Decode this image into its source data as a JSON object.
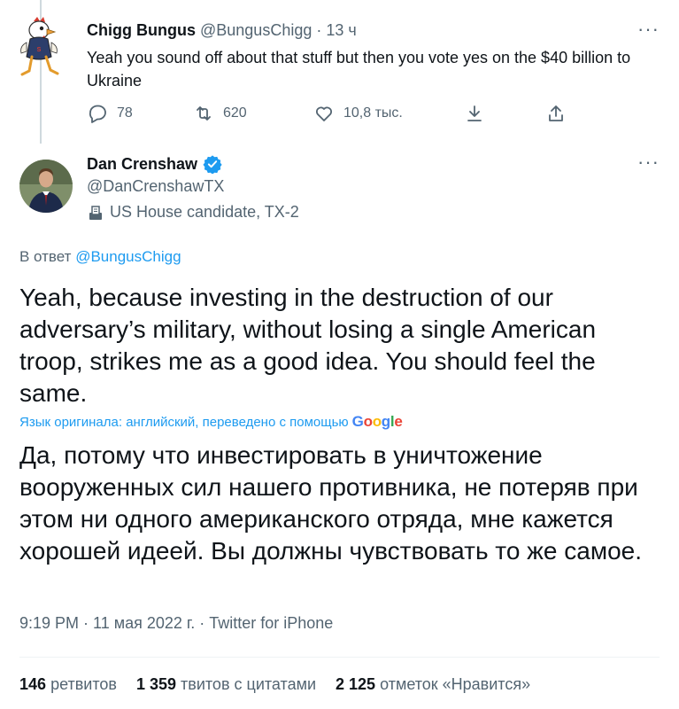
{
  "reply": {
    "name": "Chigg Bungus",
    "handle": "@BungusChigg",
    "separator": "·",
    "time": "13 ч",
    "text": "Yeah you sound off about that stuff but then you vote yes on the $40 billion to Ukraine",
    "more": "···",
    "actions": {
      "replies": "78",
      "retweets": "620",
      "likes": "10,8 тыс."
    }
  },
  "tweet": {
    "name": "Dan Crenshaw",
    "handle": "@DanCrenshawTX",
    "label": "US House candidate, TX-2",
    "more": "···",
    "replying_prefix": "В ответ",
    "replying_to": "@BungusChigg",
    "text": "Yeah, because investing in the destruction of our adversary’s military, without losing a single American troop, strikes me as a good idea. You should feel the same.",
    "translation_note": "Язык оригинала: английский, переведено с помощью",
    "translation_provider": "Google",
    "translated_text": "Да, потому что инвестировать в уничтожение вооруженных сил нашего противника, не потеряв при этом ни одного американского отряда, мне кажется хорошей идеей. Вы должны чувствовать то же самое.",
    "timestamp": "9:19 PM · 11 мая 2022 г. · Twitter for iPhone",
    "stats": [
      {
        "count": "146",
        "label": "ретвитов"
      },
      {
        "count": "1 359",
        "label": "твитов с цитатами"
      },
      {
        "count": "2 125",
        "label": "отметок «Нравится»"
      }
    ]
  },
  "colors": {
    "accent": "#1d9bf0",
    "secondary_text": "#536471",
    "primary_text": "#0f1419"
  }
}
